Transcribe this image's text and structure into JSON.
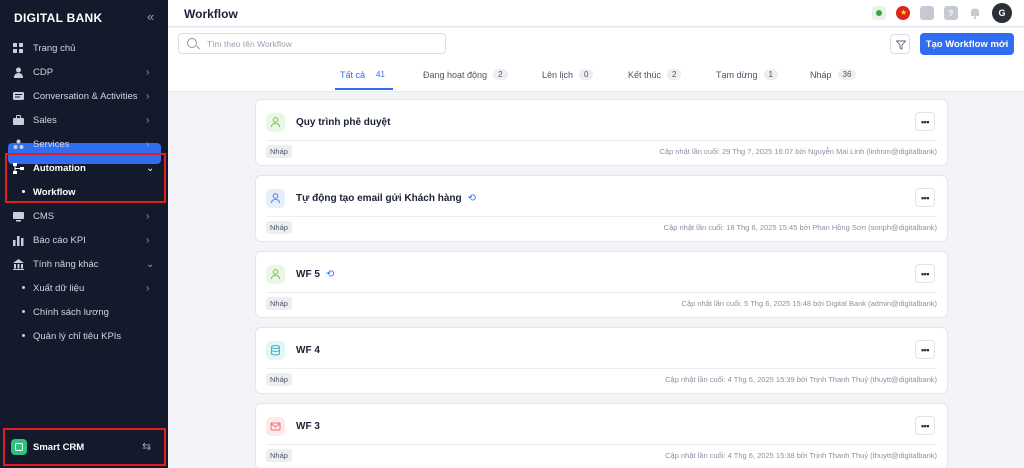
{
  "sidebar": {
    "brand": "DIGITAL BANK",
    "collapse_icon": "«",
    "items": [
      {
        "label": "Trang chủ",
        "icon": "home-icon",
        "has_chevron": false
      },
      {
        "label": "CDP",
        "icon": "user-icon",
        "has_chevron": true
      },
      {
        "label": "Conversation & Activities",
        "icon": "chat-icon",
        "has_chevron": true
      },
      {
        "label": "Sales",
        "icon": "sales-icon",
        "has_chevron": true
      },
      {
        "label": "Services",
        "icon": "services-icon",
        "has_chevron": true
      },
      {
        "label": "Automation",
        "icon": "automation-icon",
        "has_chevron": true,
        "expanded": true
      },
      {
        "label": "Workflow",
        "sub": true,
        "active": true
      },
      {
        "label": "CMS",
        "icon": "cms-icon",
        "has_chevron": true
      },
      {
        "label": "Báo cáo KPI",
        "icon": "chart-icon",
        "has_chevron": true
      },
      {
        "label": "Tính năng khác",
        "icon": "more-features-icon",
        "has_chevron": true,
        "expanded": true
      },
      {
        "label": "Xuất dữ liệu",
        "sub": true,
        "has_chevron": true
      },
      {
        "label": "Chính sách lương",
        "sub": true
      },
      {
        "label": "Quản lý chỉ tiêu KPIs",
        "sub": true
      }
    ],
    "footer": {
      "label": "Smart CRM",
      "switch_icon": "⇆"
    }
  },
  "header": {
    "title": "Workflow",
    "avatar_letter": "G"
  },
  "toolbar": {
    "search_placeholder": "Tìm theo tên Workflow",
    "create_label": "Tạo Workflow mới"
  },
  "tabs": [
    {
      "label": "Tất cả",
      "count": "41",
      "active": true
    },
    {
      "label": "Đang hoạt động",
      "count": "2"
    },
    {
      "label": "Lên lịch",
      "count": "0"
    },
    {
      "label": "Kết thúc",
      "count": "2"
    },
    {
      "label": "Tạm dừng",
      "count": "1"
    },
    {
      "label": "Nháp",
      "count": "36"
    }
  ],
  "workflows": [
    {
      "name": "Quy trình phê duyệt",
      "sync": false,
      "status": "Nháp",
      "updated": "Cập nhật lần cuối: 29 Thg 7, 2025 16:07 bởi Nguyễn Mai Linh (linhnm@digitalbank)",
      "icon": "user-icon",
      "icon_color": "#7ec85b",
      "icon_bg": "#eaf7e4"
    },
    {
      "name": "Tự động tạo email gửi Khách hàng",
      "sync": true,
      "status": "Nháp",
      "updated": "Cập nhật lần cuối: 18 Thg 6, 2025 15:45 bởi Phan Hồng Sơn (sonph@digitalbank)",
      "icon": "user-icon",
      "icon_color": "#5b8ee6",
      "icon_bg": "#e6eefc"
    },
    {
      "name": "WF 5",
      "sync": true,
      "status": "Nháp",
      "updated": "Cập nhật lần cuối: 5 Thg 6, 2025 15:48 bởi Digital Bank (admin@digitalbank)",
      "icon": "user-icon",
      "icon_color": "#7ec85b",
      "icon_bg": "#eaf7e4"
    },
    {
      "name": "WF 4",
      "sync": false,
      "status": "Nháp",
      "updated": "Cập nhật lần cuối: 4 Thg 6, 2025 15:39 bởi Trịnh Thanh Thuỷ (thuytt@digitalbank)",
      "icon": "database-icon",
      "icon_color": "#3fb6c8",
      "icon_bg": "#e2f6f8"
    },
    {
      "name": "WF 3",
      "sync": false,
      "status": "Nháp",
      "updated": "Cập nhật lần cuối: 4 Thg 6, 2025 15:38 bởi Trịnh Thanh Thuỷ (thuytt@digitalbank)",
      "icon": "mail-icon",
      "icon_color": "#e8707a",
      "icon_bg": "#fde8ea"
    }
  ],
  "colors": {
    "accent": "#2f6ef0",
    "sidebar_bg": "#121a2b",
    "highlight": "#e02020"
  }
}
